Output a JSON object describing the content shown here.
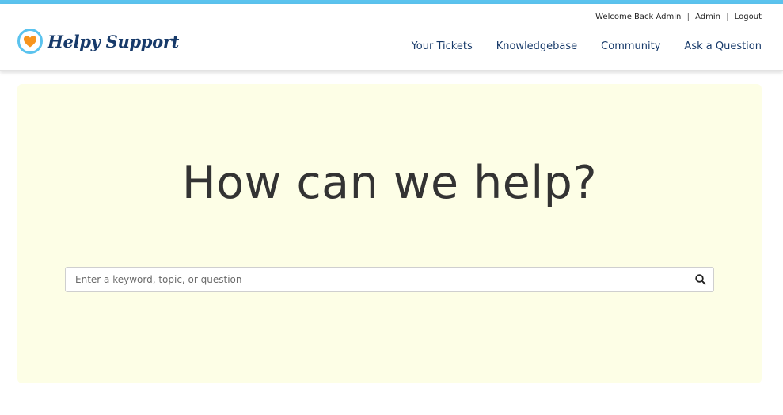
{
  "brand": {
    "name": "Helpy Support",
    "accent": "#5bc3ee",
    "text_color": "#173a6a",
    "heart_color": "#f7941d",
    "logo_icon": "heart-icon"
  },
  "user_links": {
    "welcome": "Welcome Back Admin",
    "admin": "Admin",
    "logout": "Logout",
    "separator": "|"
  },
  "nav": {
    "items": [
      {
        "label": "Your Tickets"
      },
      {
        "label": "Knowledgebase"
      },
      {
        "label": "Community"
      },
      {
        "label": "Ask a Question"
      }
    ]
  },
  "hero": {
    "title": "How can we help?",
    "background": "#fdfee6",
    "search": {
      "placeholder": "Enter a keyword, topic, or question",
      "value": "",
      "icon": "search-icon"
    }
  }
}
